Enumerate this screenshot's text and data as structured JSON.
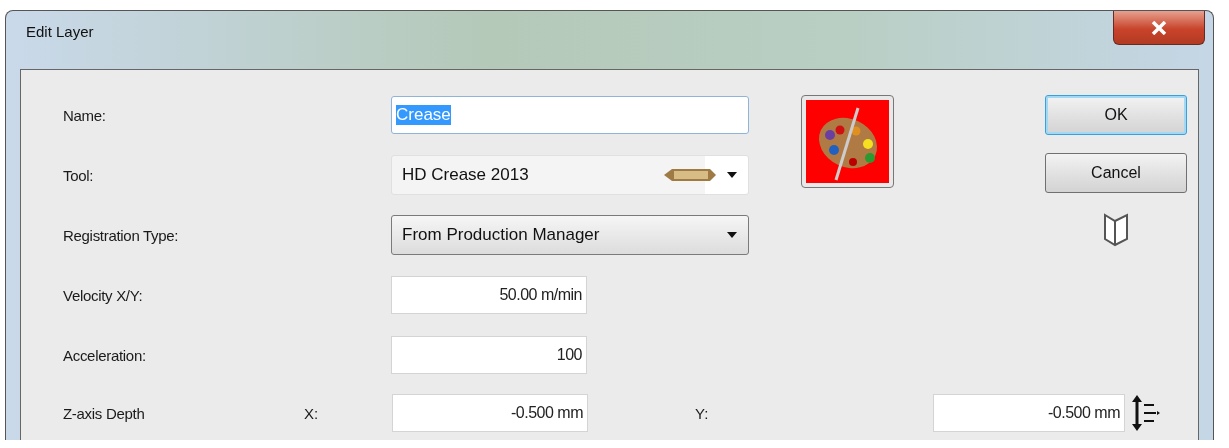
{
  "window": {
    "title": "Edit Layer"
  },
  "fields": [
    {
      "kind": "text",
      "label": "Name:",
      "value": "Crease",
      "selected": true
    },
    {
      "kind": "tool",
      "label": "Tool:",
      "value": "HD Crease 2013"
    },
    {
      "kind": "select",
      "label": "Registration Type:",
      "value": "From Production Manager"
    },
    {
      "kind": "number",
      "label": "Velocity X/Y:",
      "value": "50.00 m/min"
    },
    {
      "kind": "number",
      "label": "Acceleration:",
      "value": "100"
    }
  ],
  "z_depth": {
    "label": "Z-axis Depth",
    "x_label": "X:",
    "x_value": "-0.500 mm",
    "y_label": "Y:",
    "y_value": "-0.500 mm"
  },
  "buttons": [
    {
      "label": "OK",
      "default": true
    },
    {
      "label": "Cancel",
      "default": false
    }
  ]
}
